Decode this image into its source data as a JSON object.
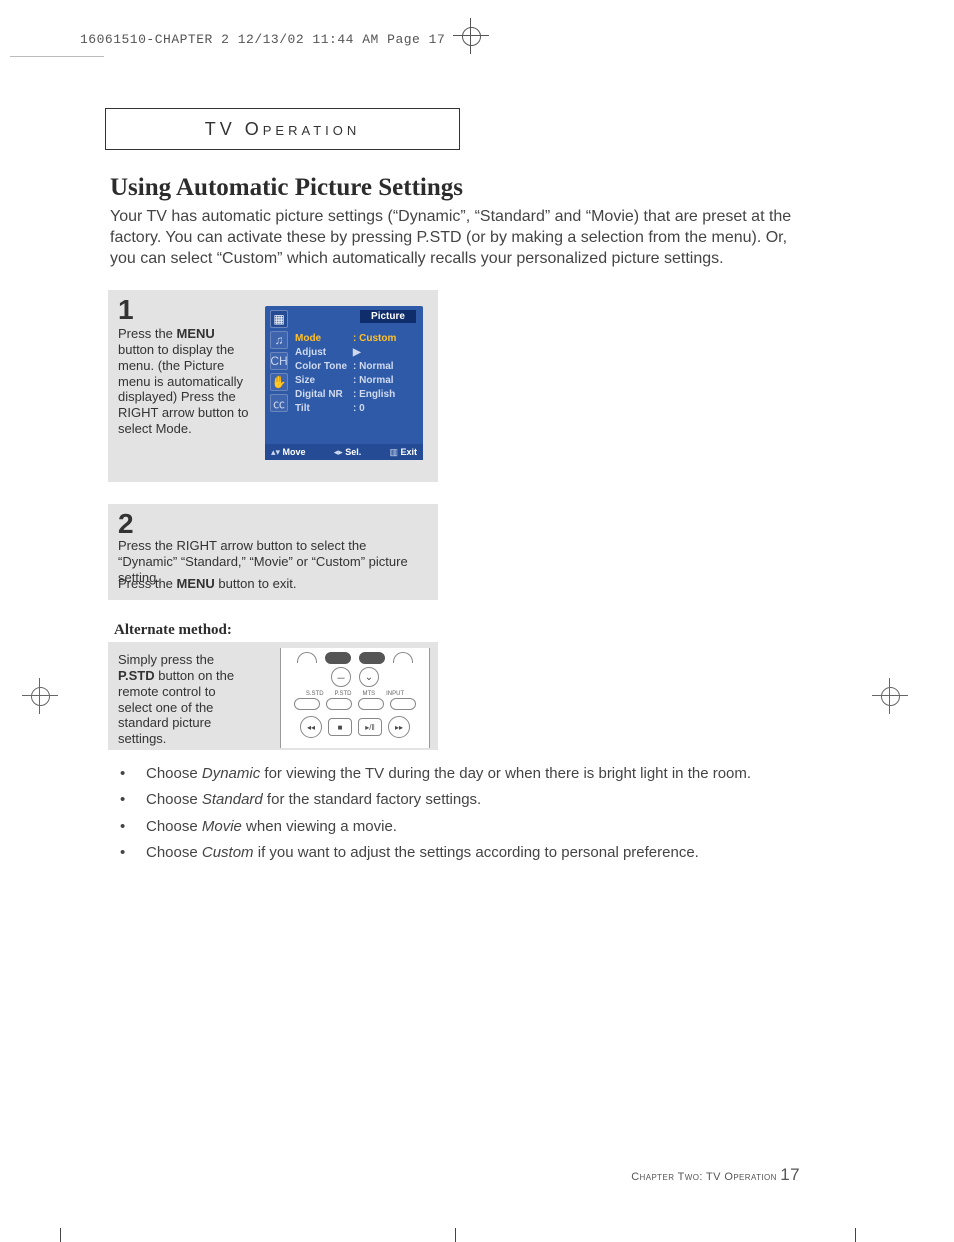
{
  "print_header": "16061510-CHAPTER 2  12/13/02 11:44 AM  Page 17",
  "section_label": "TV Operation",
  "main_title": "Using Automatic Picture Settings",
  "intro_text": "Your TV has automatic picture settings (“Dynamic”, “Standard” and “Movie) that are preset at the factory.  You can activate these by pressing P.STD (or by making a selection from the menu). Or, you can select “Custom” which automatically recalls your personalized picture settings.",
  "step1": {
    "num": "1",
    "text_pre": "Press the ",
    "text_bold": "MENU",
    "text_post": " button to display the menu. (the Picture menu is automatically displayed) Press the RIGHT arrow button to select Mode."
  },
  "step2": {
    "num": "2",
    "text": "Press the RIGHT arrow button to select the “Dynamic” “Standard,” “Movie” or “Custom” picture setting.",
    "exit_pre": "Press the ",
    "exit_bold": "MENU",
    "exit_post": " button to exit."
  },
  "alt_heading": "Alternate method:",
  "alt_text_pre": "Simply press the ",
  "alt_text_bold": "P.STD",
  "alt_text_post": " button on the remote control to select one of the standard picture settings.",
  "osd": {
    "title": "Picture",
    "rows": [
      {
        "label": "Mode",
        "value": ": Custom",
        "hl": true
      },
      {
        "label": "Adjust",
        "value": "▶"
      },
      {
        "label": "Color Tone",
        "value": ": Normal"
      },
      {
        "label": "Size",
        "value": ": Normal"
      },
      {
        "label": "Digital NR",
        "value": ": English"
      },
      {
        "label": "Tilt",
        "value": ":   0"
      }
    ],
    "bottom": {
      "move": "Move",
      "sel": "Sel.",
      "exit": "Exit"
    }
  },
  "remote_labels": {
    "sstd": "S.STD",
    "pstd": "P.STD",
    "mts": "MTS",
    "input": "INPUT"
  },
  "bullets": [
    {
      "pre": "Choose ",
      "em": "Dynamic",
      "post": " for viewing the TV during the day or when there is bright light in the room."
    },
    {
      "pre": "Choose ",
      "em": "Standard",
      "post": " for the standard factory settings."
    },
    {
      "pre": "Choose ",
      "em": "Movie",
      "post": " when viewing a movie."
    },
    {
      "pre": "Choose ",
      "em": "Custom",
      "post": " if you want to adjust the settings according to personal preference."
    }
  ],
  "footer": {
    "chapter": "Chapter Two: TV Operation ",
    "page": "17"
  }
}
